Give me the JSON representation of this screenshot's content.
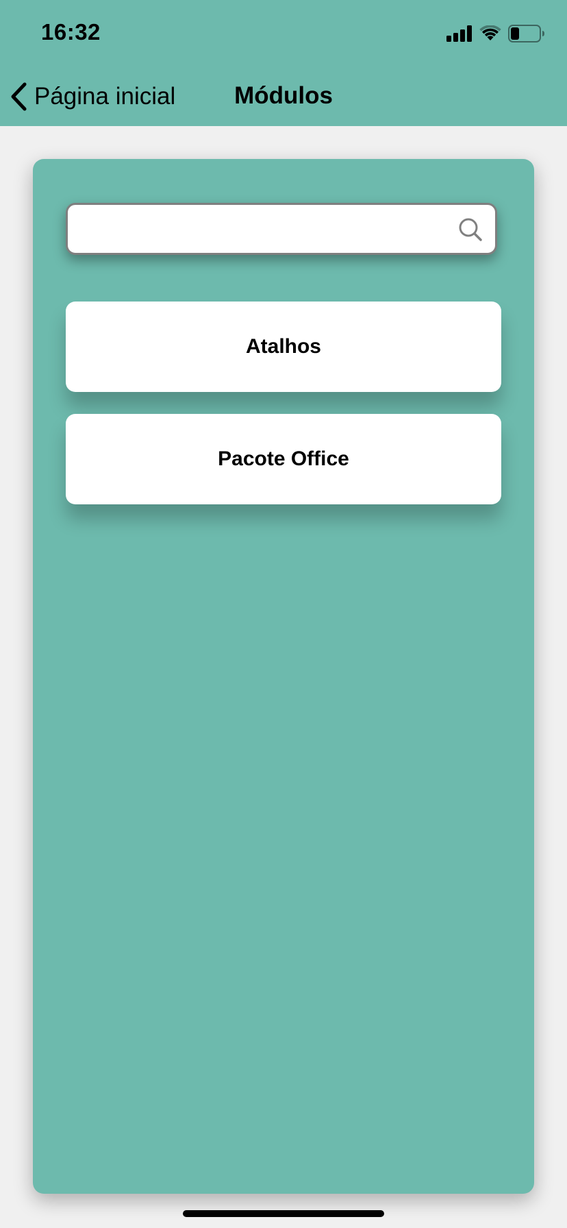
{
  "status_bar": {
    "time": "16:32",
    "signal_icon": "signal-bars-icon",
    "wifi_icon": "wifi-icon",
    "battery_icon": "battery-icon",
    "battery_level": 0.3
  },
  "nav": {
    "back_icon": "chevron-left-icon",
    "back_label": "Página inicial",
    "title": "Módulos"
  },
  "search": {
    "value": "",
    "placeholder": "",
    "icon": "search-icon"
  },
  "modules": [
    {
      "label": "Atalhos"
    },
    {
      "label": "Pacote Office"
    }
  ],
  "colors": {
    "accent": "#6dbaad",
    "background": "#f0f0f0",
    "card": "#ffffff",
    "text": "#000000"
  }
}
